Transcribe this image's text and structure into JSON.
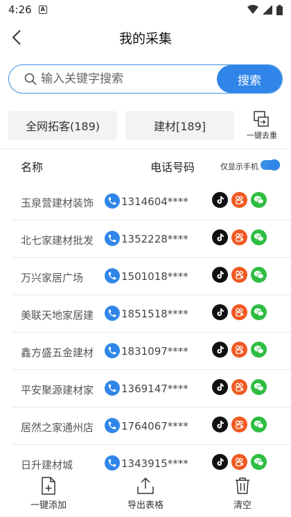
{
  "status": {
    "time": "4:26",
    "notification_glyph": "A"
  },
  "header": {
    "title": "我的采集"
  },
  "search": {
    "placeholder": "输入关键字搜索",
    "button_label": "搜索"
  },
  "tabs": [
    {
      "label": "全网拓客(189)"
    },
    {
      "label": "建材[189]"
    }
  ],
  "dedupe": {
    "label": "一键去重"
  },
  "list_header": {
    "name_col": "名称",
    "phone_col": "电话号码",
    "only_phone_label": "仅显示手机",
    "only_phone_enabled": true
  },
  "rows": [
    {
      "name": "玉泉营建材装饰",
      "phone": "1314604****"
    },
    {
      "name": "北七家建材批发",
      "phone": "1352228****"
    },
    {
      "name": "万兴家居广场",
      "phone": "1501018****"
    },
    {
      "name": "美联天地家居建",
      "phone": "1851518****"
    },
    {
      "name": "鑫方盛五金建材",
      "phone": "1831097****"
    },
    {
      "name": "平安聚源建材家",
      "phone": "1369147****"
    },
    {
      "name": "居然之家通州店",
      "phone": "1764067****"
    },
    {
      "name": "日升建材城",
      "phone": "1343915****"
    }
  ],
  "bottom_bar": [
    {
      "label": "一键添加",
      "icon": "file-add-icon"
    },
    {
      "label": "导出表格",
      "icon": "export-icon"
    },
    {
      "label": "清空",
      "icon": "trash-icon"
    }
  ],
  "colors": {
    "accent": "#2f86e8",
    "tiktok": "#111111",
    "kuaishou": "#f05a22",
    "wechat": "#2fbd42"
  }
}
